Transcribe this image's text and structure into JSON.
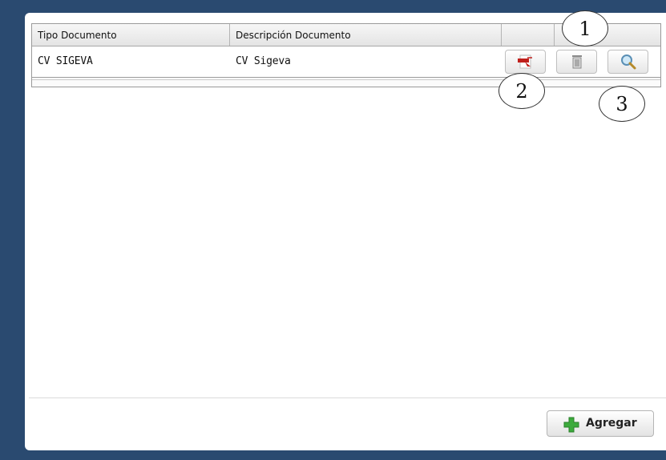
{
  "grid": {
    "headers": [
      "Tipo Documento",
      "Descripción Documento",
      "",
      ""
    ],
    "rows": [
      {
        "tipo": "CV SIGEVA",
        "descripcion": "CV Sigeva"
      }
    ]
  },
  "actions": {
    "pdf_icon": "pdf-document-icon",
    "delete_icon": "trash-icon",
    "view_icon": "magnifier-icon"
  },
  "footer": {
    "add_label": "Agregar",
    "add_icon": "plus-icon"
  },
  "callouts": [
    "1",
    "2",
    "3"
  ],
  "colors": {
    "background": "#2a4a70",
    "plus": "#3cab3c",
    "pdf": "#c0201c"
  }
}
